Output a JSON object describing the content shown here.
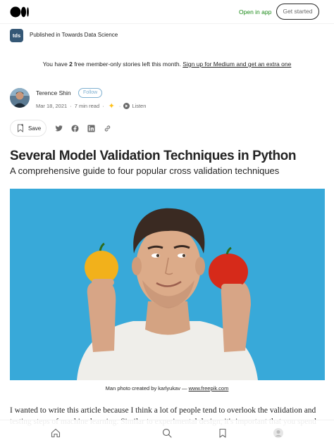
{
  "header": {
    "open_in_app": "Open in app",
    "get_started": "Get started"
  },
  "publication": {
    "icon_text": "tds",
    "text": "Published in Towards Data Science"
  },
  "banner": {
    "prefix": "You have ",
    "count": "2",
    "middle": " free member-only stories left this month. ",
    "link": "Sign up for Medium and get an extra one"
  },
  "author": {
    "name": "Terence Shin",
    "follow_label": "Follow",
    "date": "Mar 18, 2021",
    "read_time": "7 min read",
    "listen_label": "Listen"
  },
  "actions": {
    "save_label": "Save"
  },
  "article": {
    "title": "Several Model Validation Techniques in Python",
    "subtitle": "A comprehensive guide to four popular cross validation techniques",
    "caption_prefix": "Man photo created by karlyukav — ",
    "caption_link": "www.freepik.com",
    "body": "I wanted to write this article because I think a lot of people tend to overlook the validation and testing steps of machine learning. Similar to experimental design, it's important that you spend"
  },
  "colors": {
    "accent_green": "#1a8917",
    "hero_bg": "#38a9d9",
    "pub_icon_bg": "#355876"
  },
  "icons": [
    "medium-logo-icon",
    "bookmark-icon",
    "twitter-icon",
    "facebook-icon",
    "linkedin-icon",
    "link-icon",
    "home-icon",
    "search-icon",
    "bookmarks-icon",
    "profile-icon",
    "star-icon",
    "play-icon"
  ]
}
